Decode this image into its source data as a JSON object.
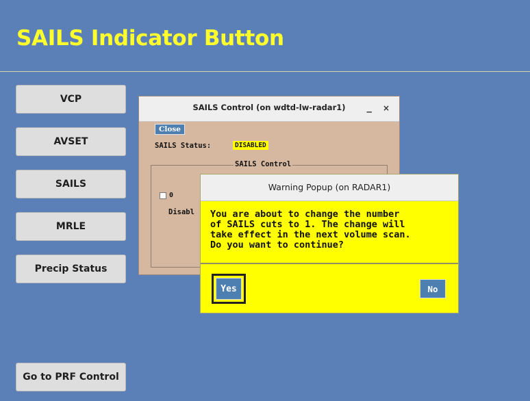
{
  "page": {
    "title": "SAILS Indicator Button"
  },
  "nav": {
    "buttons": [
      {
        "label": "VCP"
      },
      {
        "label": "AVSET"
      },
      {
        "label": "SAILS"
      },
      {
        "label": "MRLE"
      },
      {
        "label": "Precip Status"
      },
      {
        "label": "Go to PRF Control"
      }
    ]
  },
  "sails_window": {
    "title": "SAILS Control (on wdtd-lw-radar1)",
    "minimize_glyph": "_",
    "close_glyph": "×",
    "close_button": "Close",
    "status_label": "SAILS Status:",
    "status_value": "DISABLED",
    "group_label": "SAILS Control",
    "option_label": "0",
    "disabled_text": "Disabl"
  },
  "warning_popup": {
    "title": "Warning Popup (on RADAR1)",
    "message": "You are about to change the number\nof SAILS cuts to 1. The change will\ntake effect in the next volume scan.\nDo you want to continue?",
    "yes_label": "Yes",
    "no_label": "No"
  },
  "colors": {
    "background": "#5b80b7",
    "title": "#ffff2e",
    "window_bg": "#d6b8a0",
    "popup_bg": "#ffff00",
    "button_blue": "#4d7fb1",
    "status_badge": "#ffff00"
  }
}
